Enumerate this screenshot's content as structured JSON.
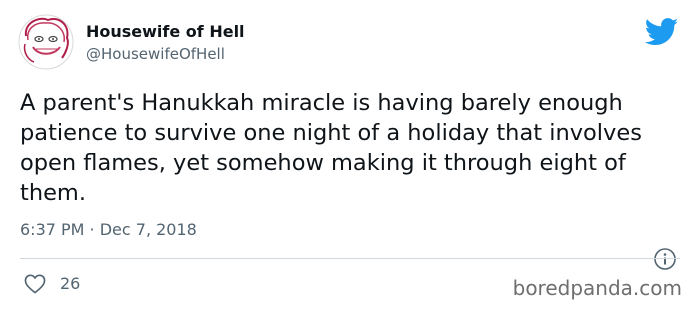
{
  "author": {
    "display_name": "Housewife of Hell",
    "handle": "@HousewifeOfHell"
  },
  "tweet": {
    "text": "A parent's Hanukkah miracle is having barely enough patience to survive one night of a holiday that involves open flames, yet somehow making it through eight of them.",
    "timestamp": "6:37 PM · Dec 7, 2018"
  },
  "engagement": {
    "likes": "26"
  },
  "watermark": "boredpanda.com",
  "icons": {
    "brand": "twitter-bird-icon",
    "info": "info-icon",
    "like": "heart-icon"
  },
  "colors": {
    "twitter_blue": "#1d9bf0",
    "text": "#0f1419",
    "muted": "#536471",
    "divider": "#cfd9de"
  }
}
